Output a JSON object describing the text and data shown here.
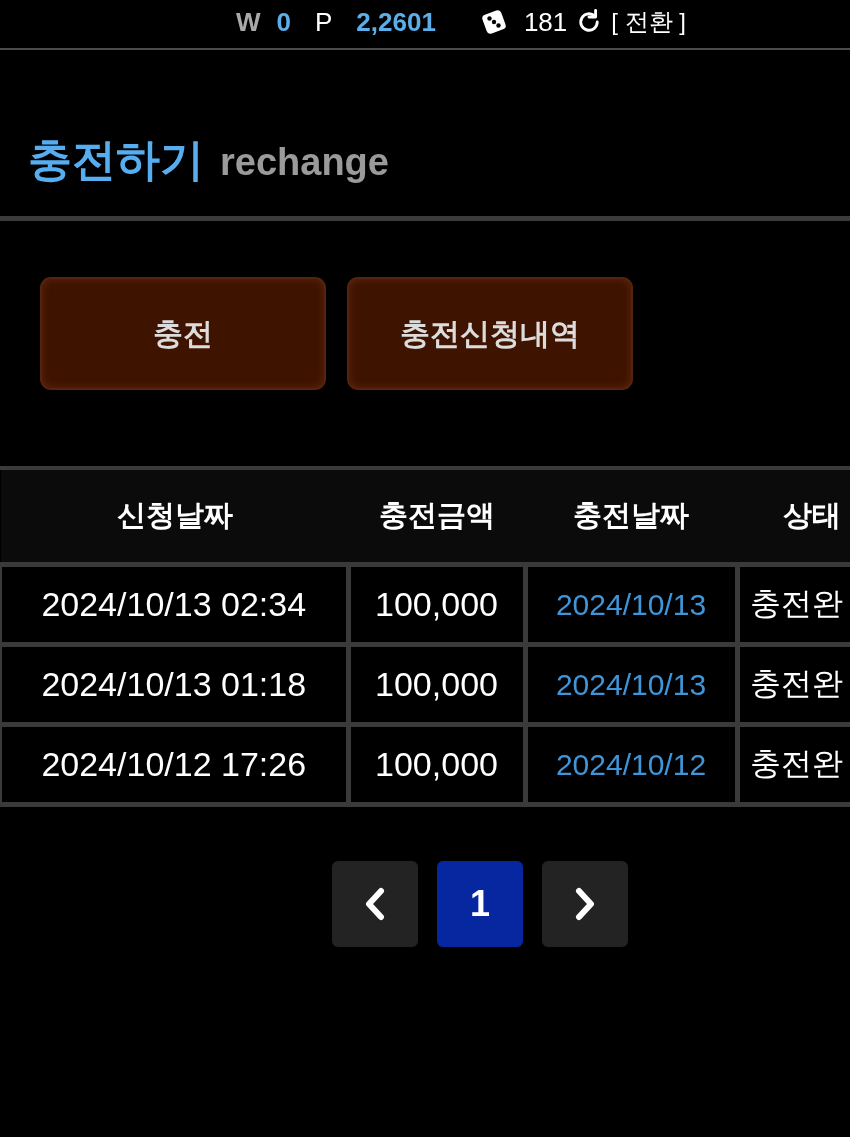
{
  "top_bar": {
    "cash_label": "W",
    "cash": "0",
    "point_label": "P",
    "points": "2,2601",
    "count": "181",
    "convert_link": "[ 전환 ]"
  },
  "header": {
    "title": "충전하기",
    "subtitle": "rechange"
  },
  "actions": [
    {
      "label": "충전"
    },
    {
      "label": "충전신청내역"
    }
  ],
  "table": {
    "columns": [
      "신청날짜",
      "충전금액",
      "충전날짜",
      "상태"
    ],
    "rows": [
      [
        "2024/10/13 02:34",
        "100,000",
        "2024/10/13",
        "충전완"
      ],
      [
        "2024/10/13 01:18",
        "100,000",
        "2024/10/13",
        "충전완"
      ],
      [
        "2024/10/12 17:26",
        "100,000",
        "2024/10/12",
        "충전완"
      ]
    ]
  },
  "pagination": {
    "items": [
      {
        "kind": "prev"
      },
      {
        "kind": "page",
        "label": "1",
        "selected": true
      },
      {
        "kind": "next"
      }
    ]
  }
}
